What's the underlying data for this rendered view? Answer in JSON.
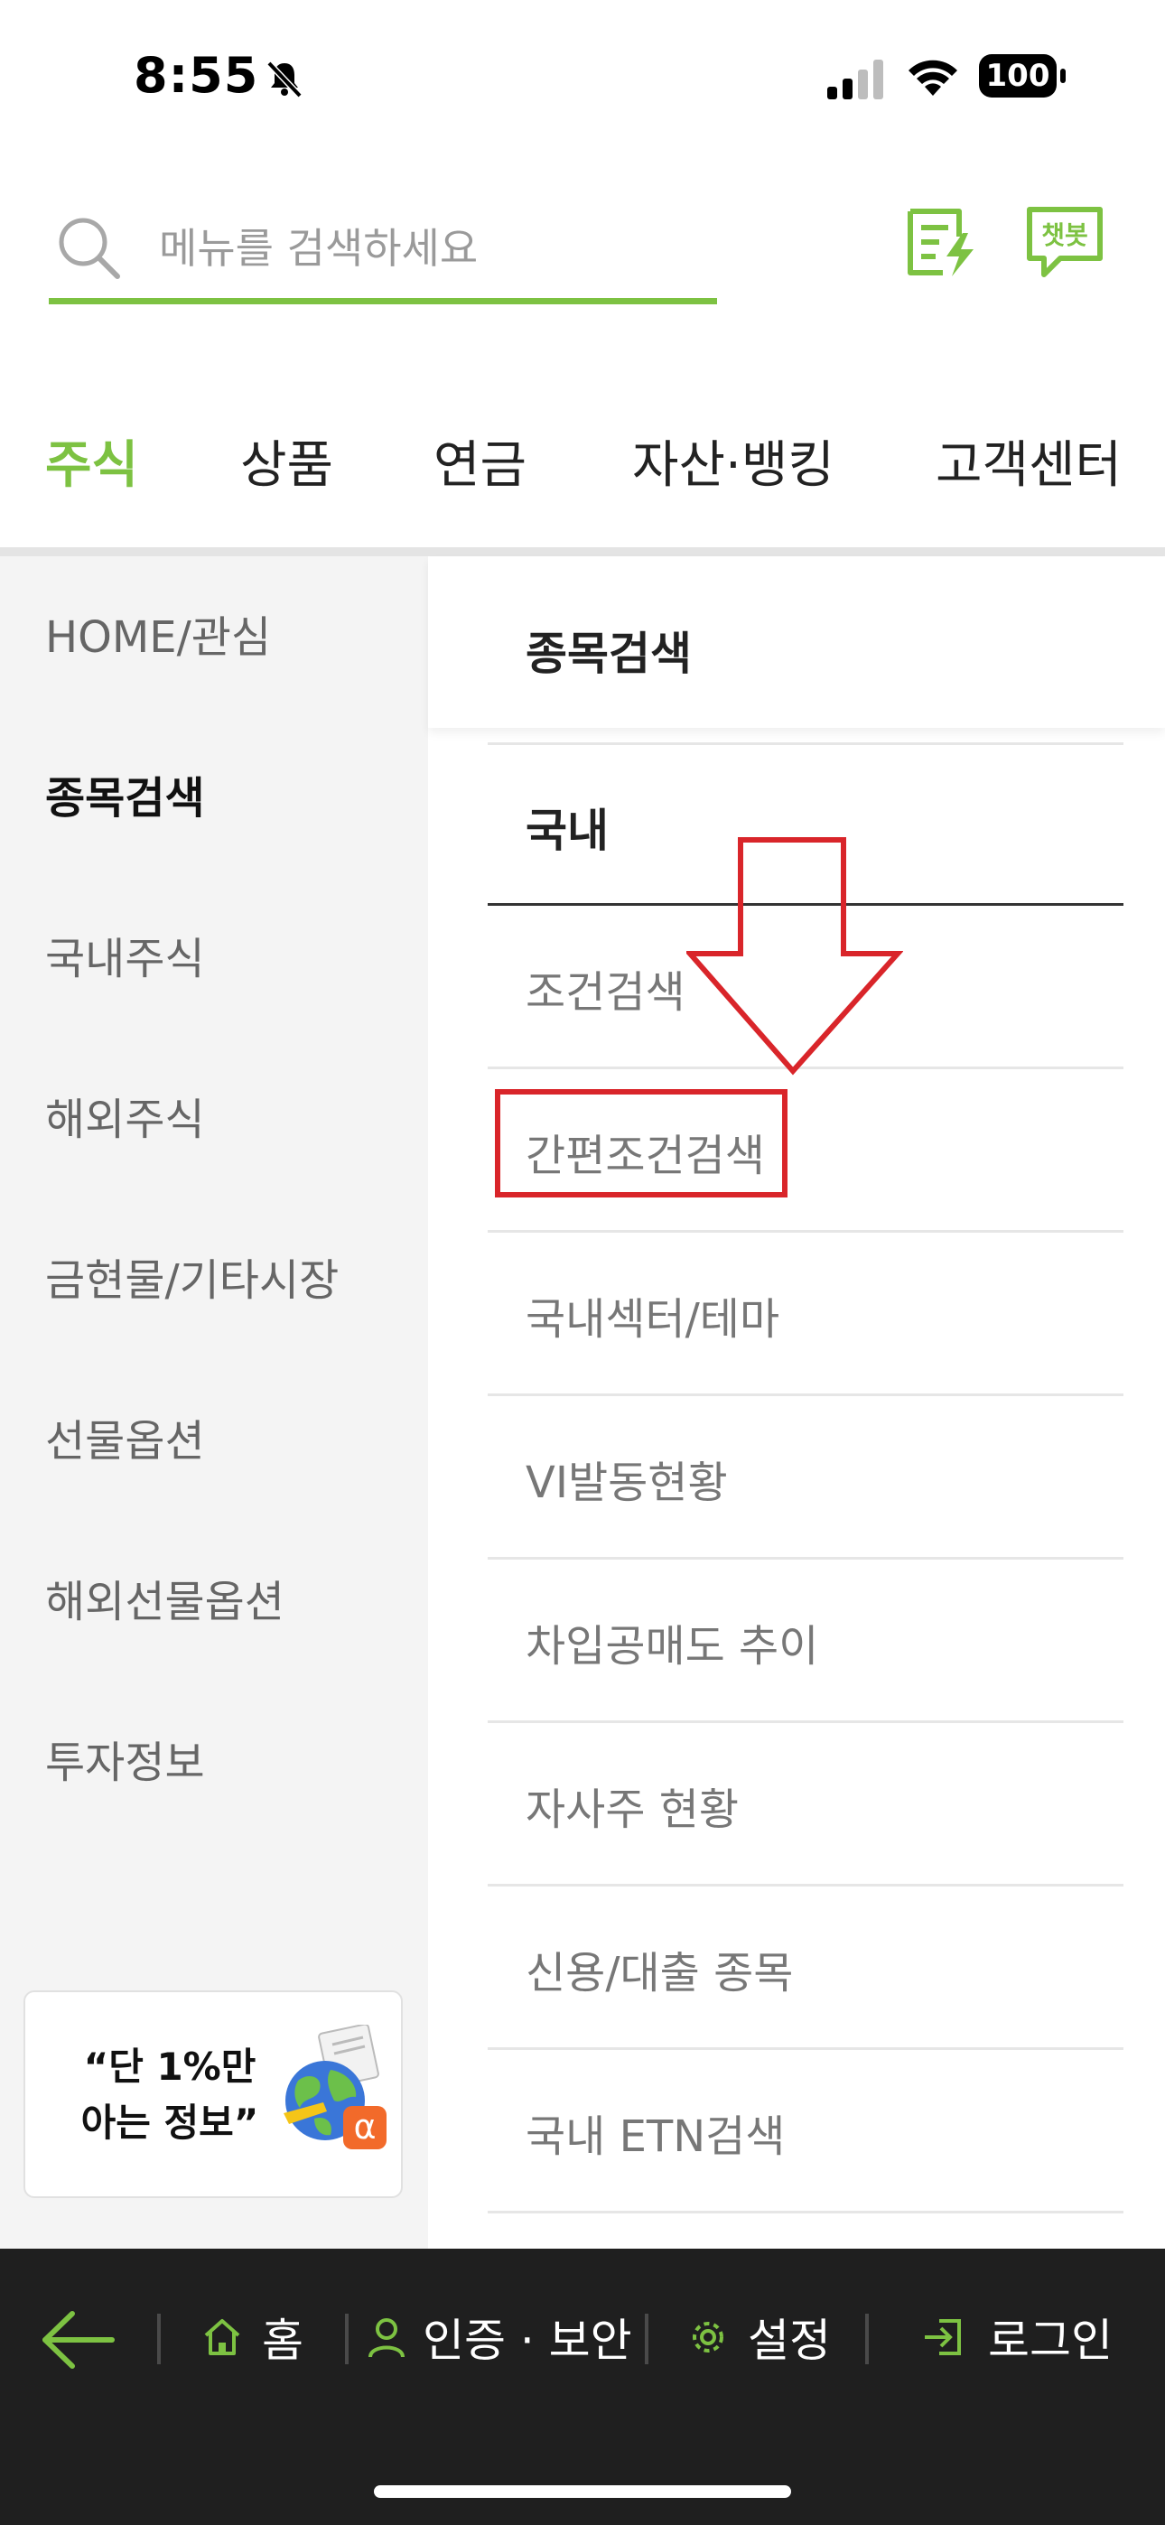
{
  "status_bar": {
    "time": "8:55",
    "battery": "100"
  },
  "search": {
    "placeholder": "메뉴를 검색하세요",
    "chatbot_label": "챗봇"
  },
  "tabs": [
    {
      "label": "주식",
      "active": true
    },
    {
      "label": "상품",
      "active": false
    },
    {
      "label": "연금",
      "active": false
    },
    {
      "label": "자산·뱅킹",
      "active": false
    },
    {
      "label": "고객센터",
      "active": false
    }
  ],
  "left_menu": [
    {
      "label": "HOME/관심",
      "active": false
    },
    {
      "label": "종목검색",
      "active": true
    },
    {
      "label": "국내주식",
      "active": false
    },
    {
      "label": "해외주식",
      "active": false
    },
    {
      "label": "금현물/기타시장",
      "active": false
    },
    {
      "label": "선물옵션",
      "active": false
    },
    {
      "label": "해외선물옵션",
      "active": false
    },
    {
      "label": "투자정보",
      "active": false
    }
  ],
  "promo": {
    "line1": "“단 1%만",
    "line2": "아는 정보”"
  },
  "panel": {
    "title": "종목검색",
    "section": "국내",
    "items": [
      "조건검색",
      "간편조건검색",
      "국내섹터/테마",
      "VI발동현황",
      "차입공매도 추이",
      "자사주 현황",
      "신용/대출 종목",
      "국내 ETN검색"
    ],
    "highlighted_index": 1
  },
  "bottom_bar": {
    "home": "홈",
    "auth": "인증 · 보안",
    "settings": "설정",
    "login": "로그인"
  },
  "colors": {
    "accent": "#7dc242",
    "annotation": "#d9252a",
    "bottom_bar": "#1f1f1f"
  }
}
